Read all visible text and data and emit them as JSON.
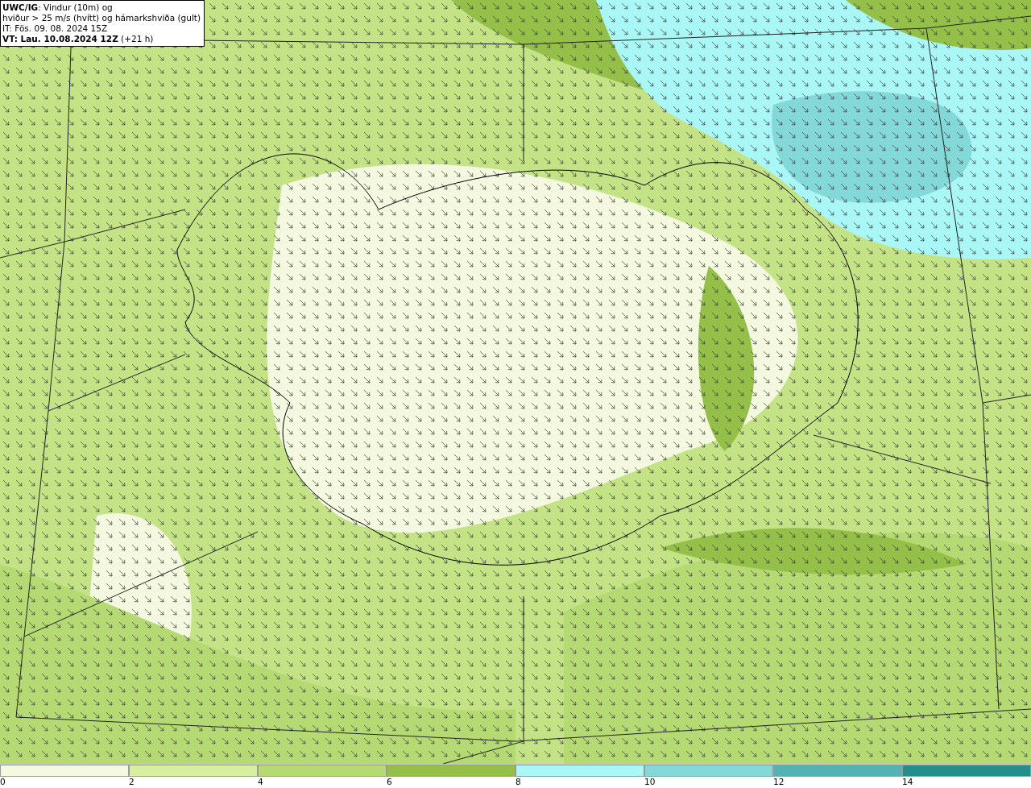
{
  "info_box": {
    "lines": [
      "**UWC/IG**: Vindur (10m) og",
      "hviður > 25 m/s (hvítt) og hámarkshviða (gult)",
      "IT: Fös. 09. 08. 2024 15Z",
      "**VT: Lau. 10.08.2024 12Z** (+21 h)"
    ]
  },
  "legend": {
    "bins": [
      {
        "label": "0",
        "color": "#f3fadf"
      },
      {
        "label": "2",
        "color": "#d6efa0"
      },
      {
        "label": "4",
        "color": "#b5da74"
      },
      {
        "label": "6",
        "color": "#94c04a"
      },
      {
        "label": "8",
        "color": "#aaf7f7"
      },
      {
        "label": "10",
        "color": "#84d8d8"
      },
      {
        "label": "12",
        "color": "#55b2b2"
      },
      {
        "label": "14",
        "color": "#258d8a"
      }
    ]
  }
}
